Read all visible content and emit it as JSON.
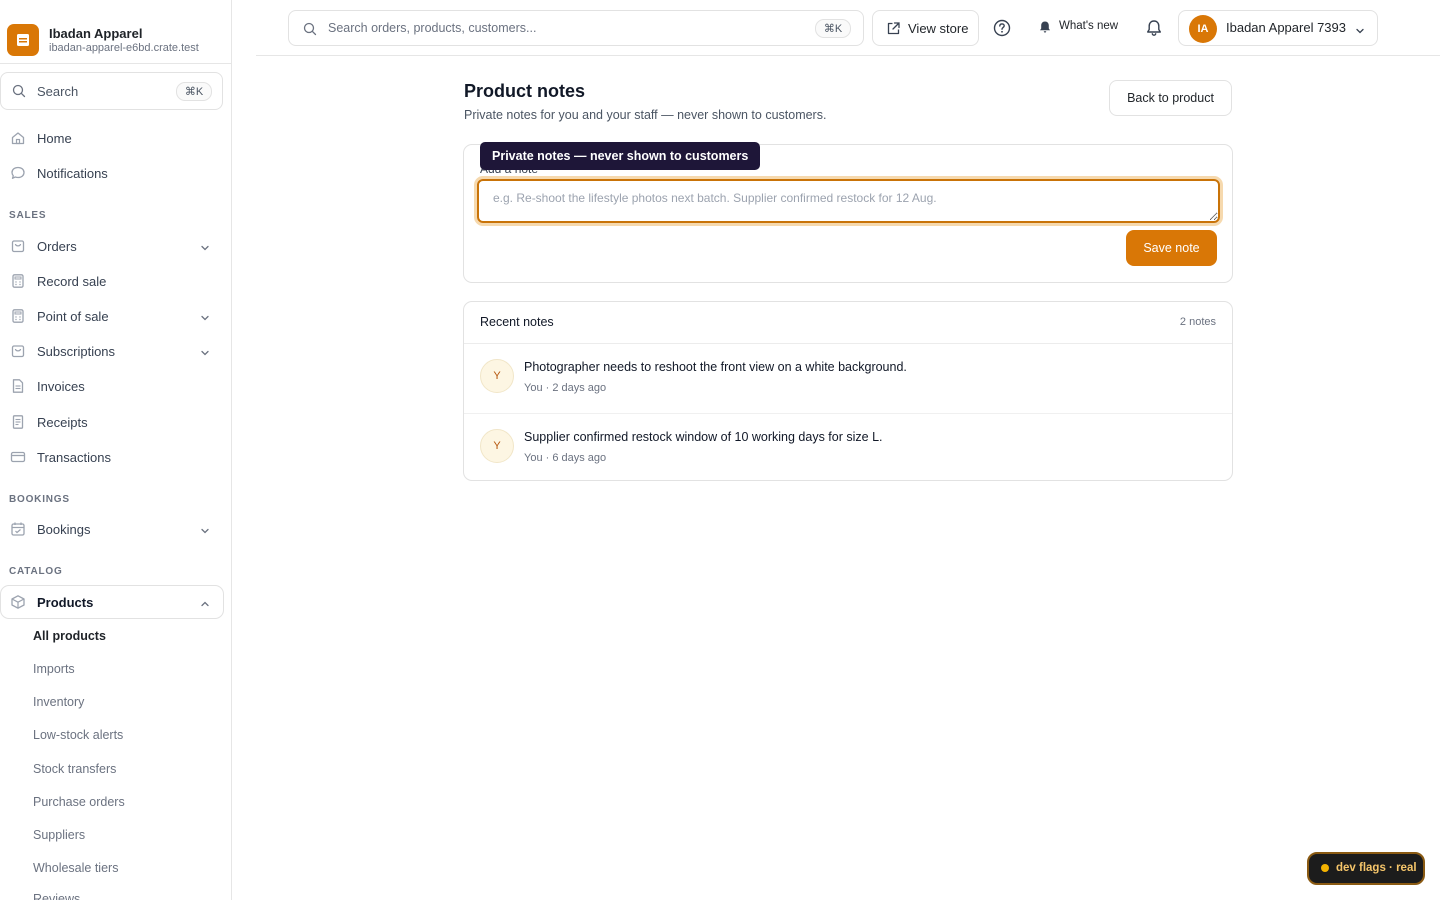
{
  "brand": {
    "name": "Ibadan Apparel",
    "domain": "ibadan-apparel-e6bd.crate.test",
    "accent": "#d97706"
  },
  "sidebar": {
    "search_label": "Search",
    "search_kbd": "⌘K",
    "top_items": [
      {
        "label": "Home",
        "icon": "home-icon"
      },
      {
        "label": "Notifications",
        "icon": "chat-bubble-icon"
      }
    ],
    "sections": {
      "sales": "SALES",
      "bookings": "BOOKINGS",
      "catalog": "CATALOG"
    },
    "sales_items": [
      {
        "label": "Orders",
        "icon": "bag-icon",
        "expandable": true
      },
      {
        "label": "Record sale",
        "icon": "calculator-icon",
        "expandable": false
      },
      {
        "label": "Point of sale",
        "icon": "calculator-icon",
        "expandable": true
      },
      {
        "label": "Subscriptions",
        "icon": "bag-icon",
        "expandable": true
      },
      {
        "label": "Invoices",
        "icon": "document-icon",
        "expandable": false
      },
      {
        "label": "Receipts",
        "icon": "receipt-icon",
        "expandable": false
      },
      {
        "label": "Transactions",
        "icon": "card-icon",
        "expandable": false
      }
    ],
    "bookings_items": [
      {
        "label": "Bookings",
        "icon": "calendar-icon",
        "expandable": true
      }
    ],
    "catalog_items": [
      {
        "label": "Products",
        "icon": "box-icon",
        "expanded": true
      }
    ],
    "product_sub_items": [
      "All products",
      "Imports",
      "Inventory",
      "Low-stock alerts",
      "Stock transfers",
      "Purchase orders",
      "Suppliers",
      "Wholesale tiers",
      "Reviews"
    ],
    "current_sub_item": "All products"
  },
  "topbar": {
    "search_placeholder": "Search orders, products, customers...",
    "search_kbd": "⌘K",
    "view_store": "View store",
    "whats_new": "What's new",
    "account_initials": "IA",
    "account_name": "Ibadan Apparel 7393"
  },
  "main": {
    "title": "Product notes",
    "subtitle": "Private notes for you and your staff — never shown to customers.",
    "back_button": "Back to product",
    "add_note_label": "Add a note",
    "tooltip": "Private notes — never shown to customers",
    "note_placeholder": "e.g. Re-shoot the lifestyle photos next batch. Supplier confirmed restock for 12 Aug.",
    "note_value": "",
    "save_button": "Save note"
  },
  "recent": {
    "title": "Recent notes",
    "count": "2 notes",
    "notes": [
      {
        "initial": "Y",
        "text": "Photographer needs to reshoot the front view on a white background.",
        "meta": "You · 2 days ago"
      },
      {
        "initial": "Y",
        "text": "Supplier confirmed restock window of 10 working days for size L.",
        "meta": "You · 6 days ago"
      }
    ]
  },
  "dev_flags": "dev flags · real"
}
